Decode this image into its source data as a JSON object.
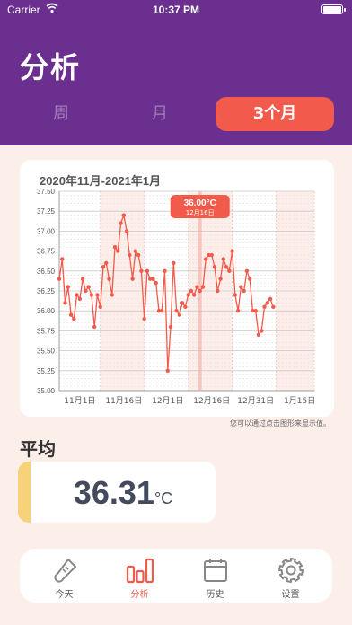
{
  "status_bar": {
    "carrier": "Carrier",
    "time": "10:37 PM"
  },
  "header": {
    "title": "分析"
  },
  "segments": [
    {
      "label": "周",
      "active": false
    },
    {
      "label": "月",
      "active": false
    },
    {
      "label": "3个月",
      "active": true
    }
  ],
  "colors": {
    "header_bg": "#6a2f8f",
    "accent_red": "#f25a4b",
    "avg_accent": "#f7d27a",
    "page_bg": "#fcefe9"
  },
  "chart_data": {
    "type": "line",
    "title": "2020年11月-2021年1月",
    "ylim": [
      35.0,
      37.5
    ],
    "y_ticks": [
      "37.50",
      "37.25",
      "37.00",
      "36.75",
      "36.50",
      "36.25",
      "36.00",
      "35.75",
      "35.50",
      "35.25",
      "35.00"
    ],
    "x_ticks": [
      "11月1日",
      "11月16日",
      "12月1日",
      "12月16日",
      "12月31日",
      "1月15日"
    ],
    "x_tick_days": [
      7,
      22,
      37,
      52,
      67,
      82
    ],
    "xlim": [
      0,
      87
    ],
    "shaded_ranges": [
      [
        14,
        29
      ],
      [
        44,
        59
      ],
      [
        74,
        87
      ]
    ],
    "series": [
      {
        "x": [
          0,
          1,
          2,
          3,
          4,
          5,
          6,
          7,
          8,
          9,
          10,
          11,
          12,
          13,
          14,
          15,
          16,
          17,
          18,
          19,
          20,
          21,
          22,
          23,
          24,
          25,
          26,
          27,
          28,
          29,
          30,
          31,
          32,
          33,
          34,
          35,
          36,
          37,
          38,
          39,
          40,
          41,
          42,
          43,
          44,
          45,
          46,
          47,
          48,
          49,
          50,
          51,
          52,
          53,
          54,
          55,
          56,
          57,
          58,
          59,
          60,
          61,
          62,
          63,
          64,
          65,
          66,
          67,
          68,
          69,
          70,
          71,
          72,
          73
        ],
        "y": [
          36.4,
          36.65,
          36.1,
          36.3,
          35.95,
          35.9,
          36.2,
          36.15,
          36.4,
          36.25,
          36.3,
          36.2,
          35.8,
          36.2,
          36.05,
          36.55,
          36.6,
          36.4,
          36.2,
          36.8,
          36.75,
          37.1,
          37.2,
          37.0,
          36.7,
          36.4,
          36.75,
          36.7,
          36.5,
          35.9,
          36.5,
          36.4,
          36.4,
          36.35,
          36.0,
          36.0,
          36.5,
          35.25,
          35.8,
          36.6,
          36.0,
          35.95,
          36.1,
          36.05,
          36.2,
          36.25,
          36.2,
          36.3,
          36.25,
          36.3,
          36.65,
          36.7,
          36.7,
          36.55,
          36.25,
          36.4,
          36.65,
          36.55,
          36.5,
          36.75,
          36.2,
          36.0,
          36.3,
          36.25,
          36.5,
          36.4,
          36.0,
          36.0,
          35.7,
          35.75,
          36.05,
          36.1,
          36.15,
          36.05
        ]
      }
    ],
    "selected_point": {
      "value": "36.00",
      "unit": "°C",
      "date": "12月16日",
      "x": 48
    }
  },
  "hint": "您可以通过点击图形来显示值。",
  "average": {
    "label": "平均",
    "value": "36.31",
    "unit": "°C"
  },
  "tabs": [
    {
      "label": "今天",
      "icon": "thermometer-icon",
      "active": false
    },
    {
      "label": "分析",
      "icon": "bar-chart-icon",
      "active": true
    },
    {
      "label": "历史",
      "icon": "calendar-icon",
      "active": false
    },
    {
      "label": "设置",
      "icon": "gear-icon",
      "active": false
    }
  ]
}
